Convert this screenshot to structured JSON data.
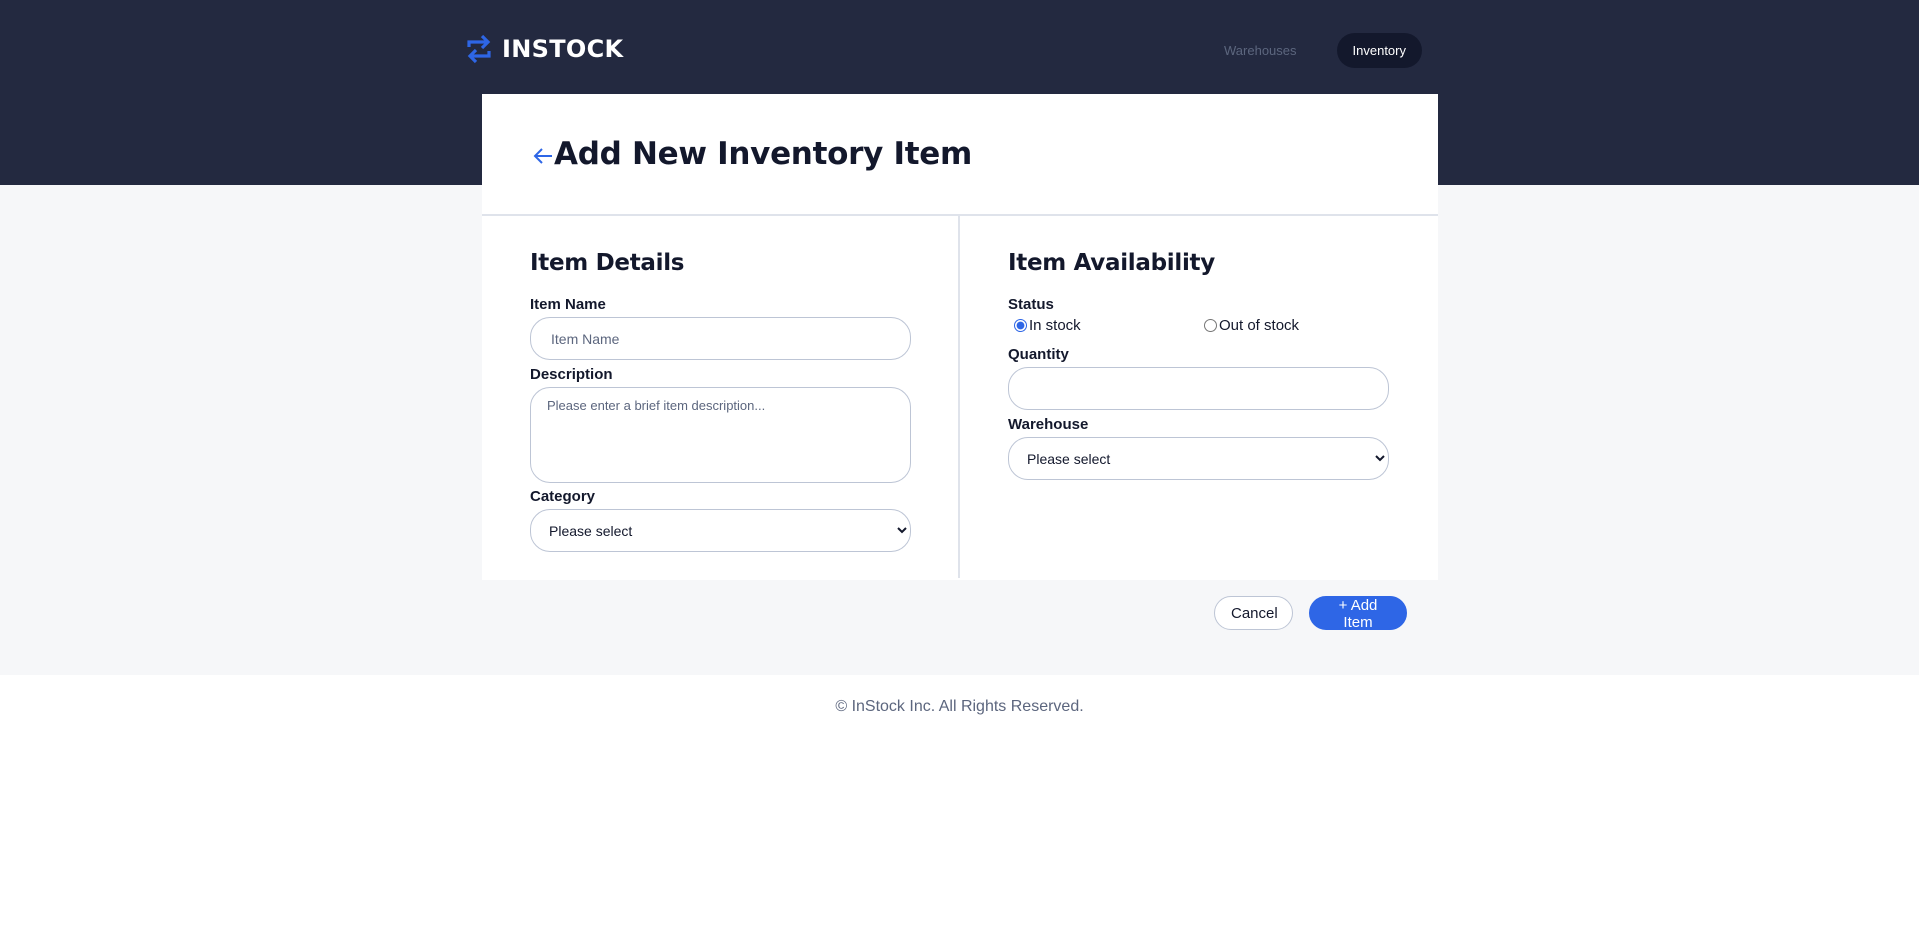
{
  "header": {
    "logo_text": "INSTOCK",
    "logo_icon": "swap-arrows-icon",
    "nav": [
      {
        "label": "Warehouses",
        "active": false
      },
      {
        "label": "Inventory",
        "active": true
      }
    ]
  },
  "page": {
    "title": "Add New Inventory Item",
    "back_icon": "arrow-left-icon"
  },
  "item_details": {
    "title": "Item Details",
    "item_name_label": "Item Name",
    "item_name_placeholder": "Item Name",
    "item_name_value": "",
    "description_label": "Description",
    "description_placeholder": "Please enter a brief item description...",
    "category_label": "Category",
    "category_selected": "Please select"
  },
  "item_availability": {
    "title": "Item Availability",
    "status_label": "Status",
    "status_options": [
      "In stock",
      "Out of stock"
    ],
    "status_selected": "In stock",
    "quantity_label": "Quantity",
    "quantity_value": "",
    "warehouse_label": "Warehouse",
    "warehouse_selected": "Please select"
  },
  "actions": {
    "cancel_label": "Cancel",
    "add_label": "+ Add Item"
  },
  "footer": {
    "text": "© InStock Inc. All Rights Reserved."
  },
  "colors": {
    "header_bg": "#232940",
    "page_bg": "#f6f7f9",
    "accent": "#2e66e6",
    "text_dark": "#13182c",
    "text_muted": "#5c667e"
  }
}
